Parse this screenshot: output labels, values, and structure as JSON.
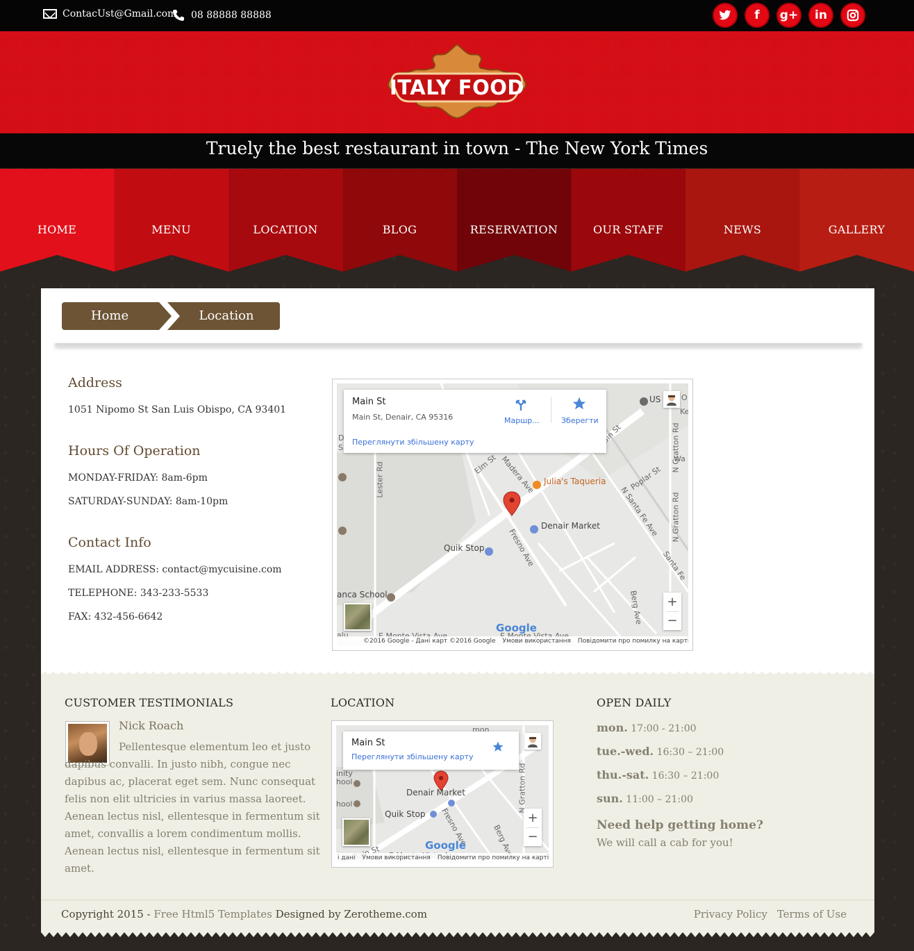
{
  "topbar": {
    "email": "ContacUst@Gmail.com",
    "phone": "08 88888 88888",
    "socials": [
      {
        "name": "twitter-icon",
        "glyph": "t"
      },
      {
        "name": "facebook-icon",
        "glyph": "f"
      },
      {
        "name": "google-plus-icon",
        "glyph": "g+"
      },
      {
        "name": "linkedin-icon",
        "glyph": "in"
      },
      {
        "name": "instagram-icon",
        "glyph": "◙"
      }
    ]
  },
  "header": {
    "logo_text": "ITALY FOOD",
    "tagline": "Truely the best restaurant in town - The New York Times"
  },
  "nav": {
    "items": [
      "HOME",
      "MENU",
      "LOCATION",
      "BLOG",
      "RESERVATION",
      "OUR STAFF",
      "NEWS",
      "GALLERY"
    ],
    "colors": [
      "#e2101a",
      "#c10d12",
      "#a70a0e",
      "#8f080a",
      "#700408",
      "#9a080b",
      "#a8160f",
      "#b71d12"
    ]
  },
  "breadcrumb": {
    "home": "Home",
    "current": "Location"
  },
  "info": {
    "address_title": "Address",
    "address": "1051 Nipomo St San Luis Obispo, CA 93401",
    "hours_title": "Hours Of Operation",
    "hours_weekday": "MONDAY-FRIDAY: 8am-6pm",
    "hours_weekend": "SATURDAY-SUNDAY: 8am-10pm",
    "contact_title": "Contact Info",
    "email": "EMAIL ADDRESS: contact@mycuisine.com",
    "telephone": "TELEPHONE: 343-233-5533",
    "fax": "FAX: 432-456-6642"
  },
  "map_main": {
    "title": "Main St",
    "address": "Main St, Denair, CA 95316",
    "directions": "Маршр...",
    "save": "Зберегти",
    "larger_map": "Переглянути збільшену карту",
    "labels": {
      "julias": "Julia's Taqueria",
      "denair_market": "Denair Market",
      "quik_stop": "Quik Stop",
      "school": "anca School",
      "elm": "Elm St",
      "madera": "Madera Ave",
      "fresno": "Fresno Ave",
      "lester": "Lester Rd",
      "poplar": "Poplar St",
      "santa_fe": "N Santa Fe Ave",
      "santa_fe2": "Santa Fe",
      "gratton": "N Gratton Rd",
      "gratton2": "N Gratton Rd",
      "berg": "Berg Ave",
      "monte": "E Monte Vista Ave",
      "monte2": "E Monte Vista Ave",
      "main_st": "ain St",
      "us": "US",
      "wa": "Wa",
      "ke": "Ke",
      "o": "O",
      "d": "D",
      "s": "S",
      "alu": "alu"
    },
    "google": "Google",
    "footer_data": "©2016 Google - Дані карт ©2016 Google",
    "footer_terms": "Умови використання",
    "footer_report": "Повідомити про помилку на карті",
    "zoom_in": "+",
    "zoom_out": "−"
  },
  "footer": {
    "testimonials_title": "CUSTOMER TESTIMONIALS",
    "testimonial_name": "Nick Roach",
    "testimonial_text": "Pellentesque elementum leo et justo dapibus convalli. In justo nibh, congue nec dapibus ac, placerat eget sem. Nunc consequat felis non elit ultricies in varius massa laoreet. Aenean lectus nisl, ellentesque in fermentum sit amet, convallis a lorem condimentum mollis. Aenean lectus nisl, ellentesque in fermentum sit amet.",
    "location_title": "LOCATION",
    "open_title": "OPEN DAILY",
    "hours": [
      {
        "day": "mon.",
        "time": "17:00 - 21:00"
      },
      {
        "day": "tue.-wed.",
        "time": "16:30 – 21:00"
      },
      {
        "day": "thu.-sat.",
        "time": "16:30 – 21:00"
      },
      {
        "day": "sun.",
        "time": "11:00 – 21:00"
      }
    ],
    "help_title": "Need help getting home?",
    "help_text": "We will call a cab for you!",
    "copyright": "Copyright 2015 - ",
    "copyright_link": "Free Html5 Templates",
    "copyright_tail": " Designed by Zerotheme.com",
    "privacy": "Privacy Policy",
    "terms": "Terms of Use"
  },
  "map_small": {
    "title": "Main St",
    "larger_map": "Переглянути збільшену карту",
    "labels": {
      "denair_market": "Denair Market",
      "quik_stop": "Quik Stop",
      "fresno": "Fresno Ave",
      "berg": "Berg Ave",
      "gratton": "N Gratton Rd",
      "monte": "E Monte Vista Ave",
      "main": "Main St",
      "inity": "inity",
      "hool": "hool",
      "hool2": "hool",
      "mon": "mon"
    },
    "google": "Google",
    "footer_data": "і дані",
    "footer_terms": "Умови використання",
    "footer_report": "Повідомити про помилку на карті",
    "zoom_in": "+",
    "zoom_out": "−"
  }
}
